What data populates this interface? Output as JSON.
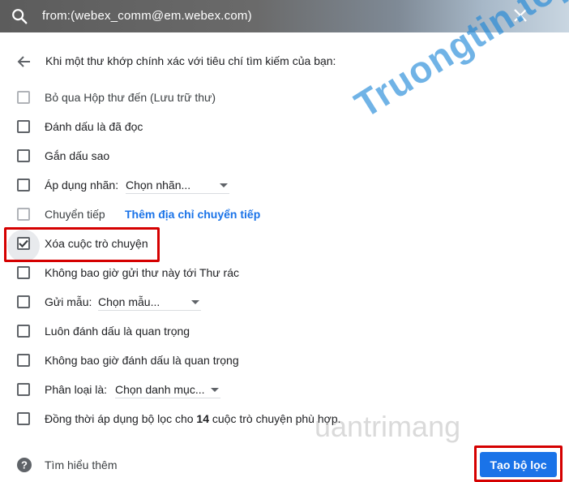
{
  "search": {
    "query": "from:(webex_comm@em.webex.com)"
  },
  "header": {
    "criteria_text": "Khi một thư khớp chính xác với tiêu chí tìm kiếm của bạn:"
  },
  "options": {
    "skip_inbox": "Bỏ qua Hộp thư đến (Lưu trữ thư)",
    "mark_read": "Đánh dấu là đã đọc",
    "star": "Gắn dấu sao",
    "apply_label": "Áp dụng nhãn:",
    "apply_label_select": "Chọn nhãn...",
    "forward": "Chuyển tiếp",
    "forward_link": "Thêm địa chỉ chuyển tiếp",
    "delete": "Xóa cuộc trò chuyện",
    "never_spam": "Không bao giờ gửi thư này tới Thư rác",
    "send_template": "Gửi mẫu:",
    "send_template_select": "Chọn mẫu...",
    "always_important": "Luôn đánh dấu là quan trọng",
    "never_important": "Không bao giờ đánh dấu là quan trọng",
    "categorize": "Phân loại là:",
    "categorize_select": "Chọn danh mục...",
    "also_apply_prefix": "Đồng thời áp dụng bộ lọc cho ",
    "also_apply_count": "14",
    "also_apply_suffix": " cuộc trò chuyện phù hợp."
  },
  "footer": {
    "learn_more": "Tìm hiểu thêm",
    "create_filter": "Tạo bộ lọc"
  },
  "watermarks": {
    "brand1": "Truongtin.top",
    "brand2": "uantrimang"
  }
}
